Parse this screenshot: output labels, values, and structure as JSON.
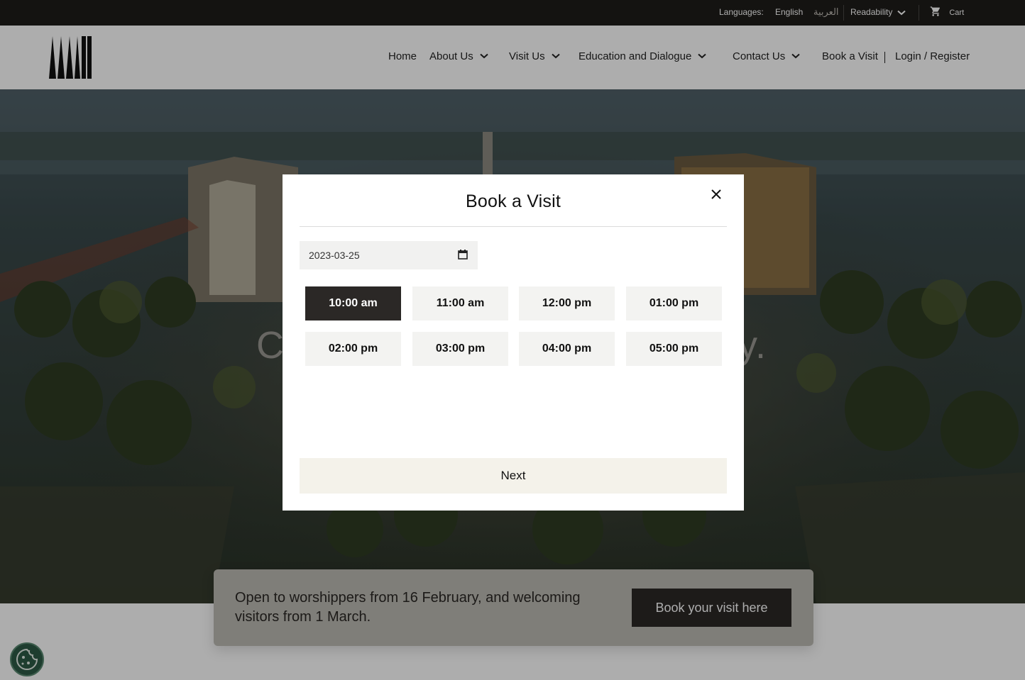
{
  "topbar": {
    "languages_label": "Languages:",
    "english": "English",
    "arabic": "العربية",
    "readability": "Readability",
    "cart": "Cart"
  },
  "nav": {
    "home": "Home",
    "about": "About Us",
    "visit": "Visit Us",
    "education": "Education and Dialogue",
    "contact": "Contact Us",
    "book": "Book a Visit",
    "login": "Login / Register"
  },
  "hero": {
    "title_left": "C",
    "title_right": "y."
  },
  "banner": {
    "text": "Open to worshippers from 16 February, and welcoming visitors from 1 March.",
    "button": "Book your visit here"
  },
  "modal": {
    "title": "Book a Visit",
    "date_value": "2023-03-25",
    "slots": [
      "10:00 am",
      "11:00 am",
      "12:00 pm",
      "01:00 pm",
      "02:00 pm",
      "03:00 pm",
      "04:00 pm",
      "05:00 pm"
    ],
    "selected_slot": "10:00 am",
    "next": "Next"
  },
  "colors": {
    "dark": "#2b2826",
    "topbar": "#1e1c1a",
    "light_button": "#f4f2ea"
  }
}
